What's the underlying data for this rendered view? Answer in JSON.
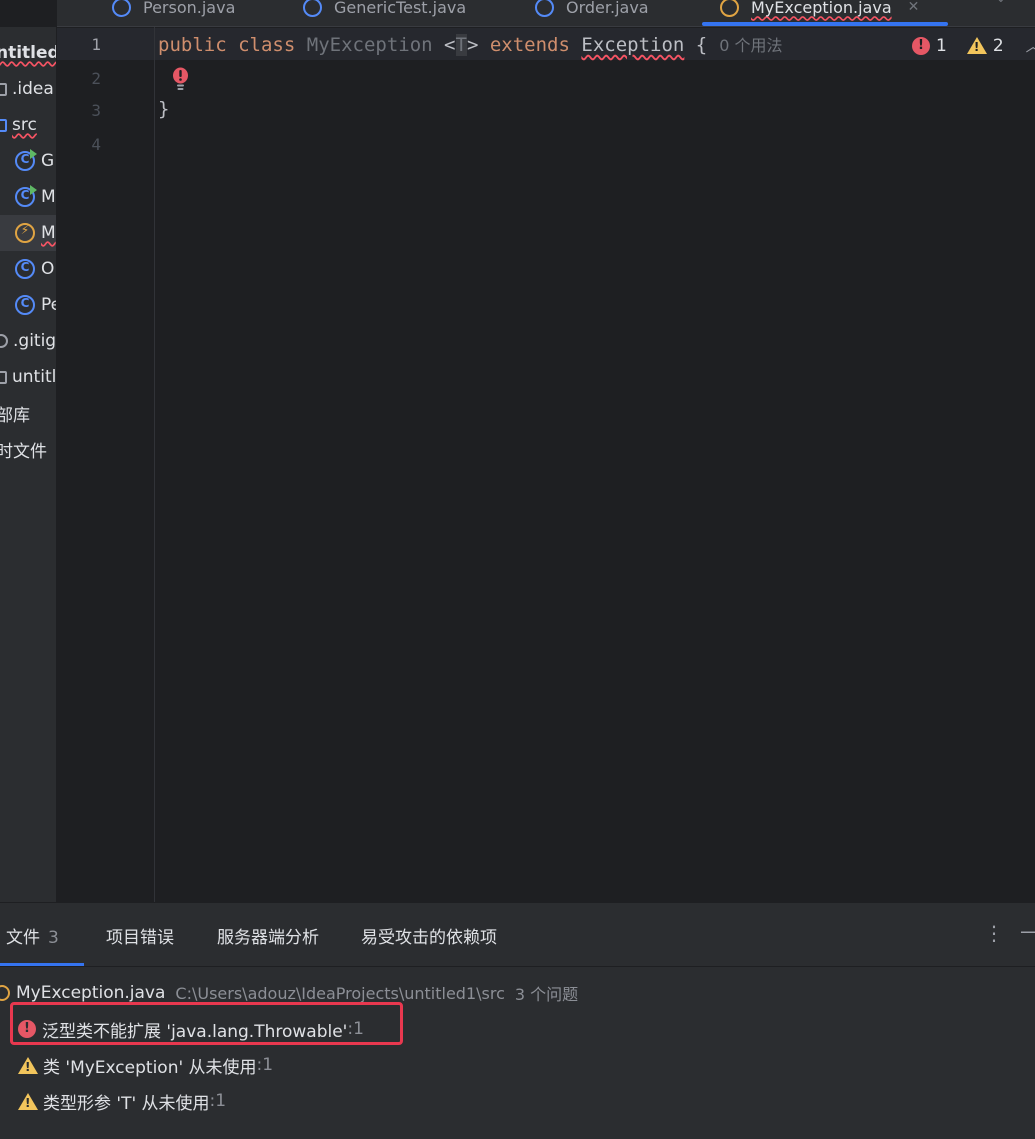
{
  "tabs": [
    {
      "label": "Person.java",
      "active": false
    },
    {
      "label": "GenericTest.java",
      "active": false
    },
    {
      "label": "Order.java",
      "active": false
    },
    {
      "label": "MyException.java",
      "active": true
    }
  ],
  "tree": {
    "items": [
      {
        "label": "ntitled"
      },
      {
        "label": ".idea"
      },
      {
        "label": "src"
      },
      {
        "label": "G"
      },
      {
        "label": "M"
      },
      {
        "label": "M"
      },
      {
        "label": "O"
      },
      {
        "label": "Pe"
      },
      {
        "label": ".gitig"
      },
      {
        "label": "untitl"
      },
      {
        "label": "部库"
      },
      {
        "label": "时文件"
      }
    ]
  },
  "editor": {
    "line_numbers": [
      "1",
      "2",
      "3",
      "4"
    ],
    "line1": {
      "kw_public": "public",
      "kw_class": "class",
      "class_name": "MyException",
      "lt": "<",
      "type_param": "T",
      "gt": ">",
      "kw_extends": "extends",
      "super_class": "Exception",
      "brace_open": "{",
      "usage_hint": "0 个用法"
    },
    "line3": "}",
    "inspections": {
      "errors": "1",
      "warnings": "2"
    }
  },
  "problems": {
    "tabs": [
      {
        "label": "文件",
        "count": "3"
      },
      {
        "label": "项目错误"
      },
      {
        "label": "服务器端分析"
      },
      {
        "label": "易受攻击的依赖项"
      }
    ],
    "file": {
      "name": "MyException.java",
      "path": "C:\\Users\\adouz\\IdeaProjects\\untitled1\\src",
      "issue_count": "3 个问题"
    },
    "items": [
      {
        "severity": "error",
        "text": "泛型类不能扩展 'java.lang.Throwable'",
        "line": ":1"
      },
      {
        "severity": "warning",
        "text": "类 'MyException' 从未使用",
        "line": ":1"
      },
      {
        "severity": "warning",
        "text": "类型形参 'T' 从未使用",
        "line": ":1"
      }
    ]
  },
  "colors": {
    "accent": "#3574f0",
    "error": "#e55765",
    "warning": "#f2c55c",
    "keyword": "#cf8e6d",
    "highlight_box": "#e8384f"
  }
}
